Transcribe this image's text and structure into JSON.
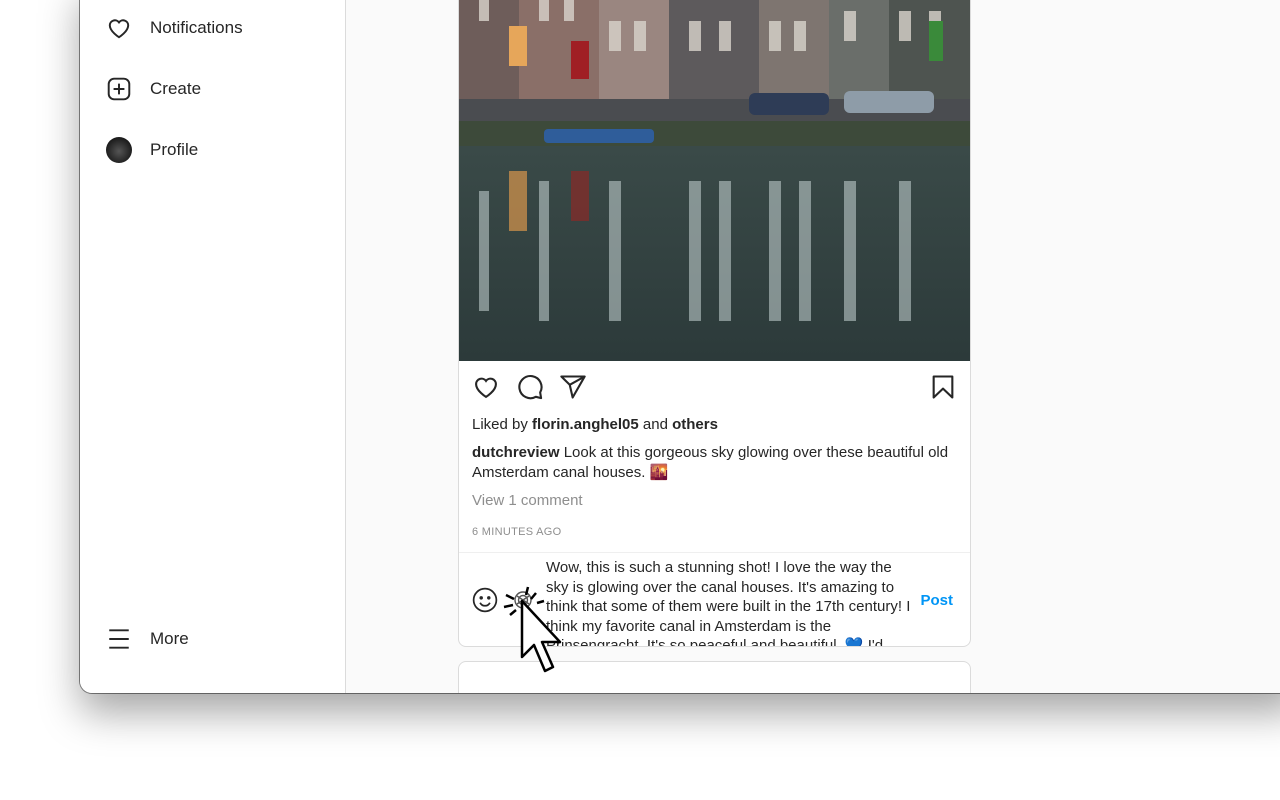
{
  "sidebar": {
    "items": [
      {
        "label": "Notifications",
        "icon": "heart-icon"
      },
      {
        "label": "Create",
        "icon": "plus-square-icon"
      },
      {
        "label": "Profile",
        "icon": "avatar"
      }
    ],
    "more": "More"
  },
  "post": {
    "liked_prefix": "Liked by",
    "liked_user": "florin.anghel05",
    "liked_and": "and",
    "liked_others": "others",
    "author": "dutchreview",
    "caption": "Look at this gorgeous sky glowing over these beautiful old Amsterdam canal houses. 🌇",
    "view_comments": "View 1 comment",
    "time": "6 MINUTES AGO",
    "comment_draft": "Wow, this is such a stunning shot! I love the way the sky is glowing over the canal houses. It's amazing to think that some of them were built in the 17th century! I think my favorite canal in Amsterdam is the Prinsengracht. It's so peaceful and beautiful. 💙 I'd",
    "post_label": "Post",
    "accent": "#0095f6"
  }
}
